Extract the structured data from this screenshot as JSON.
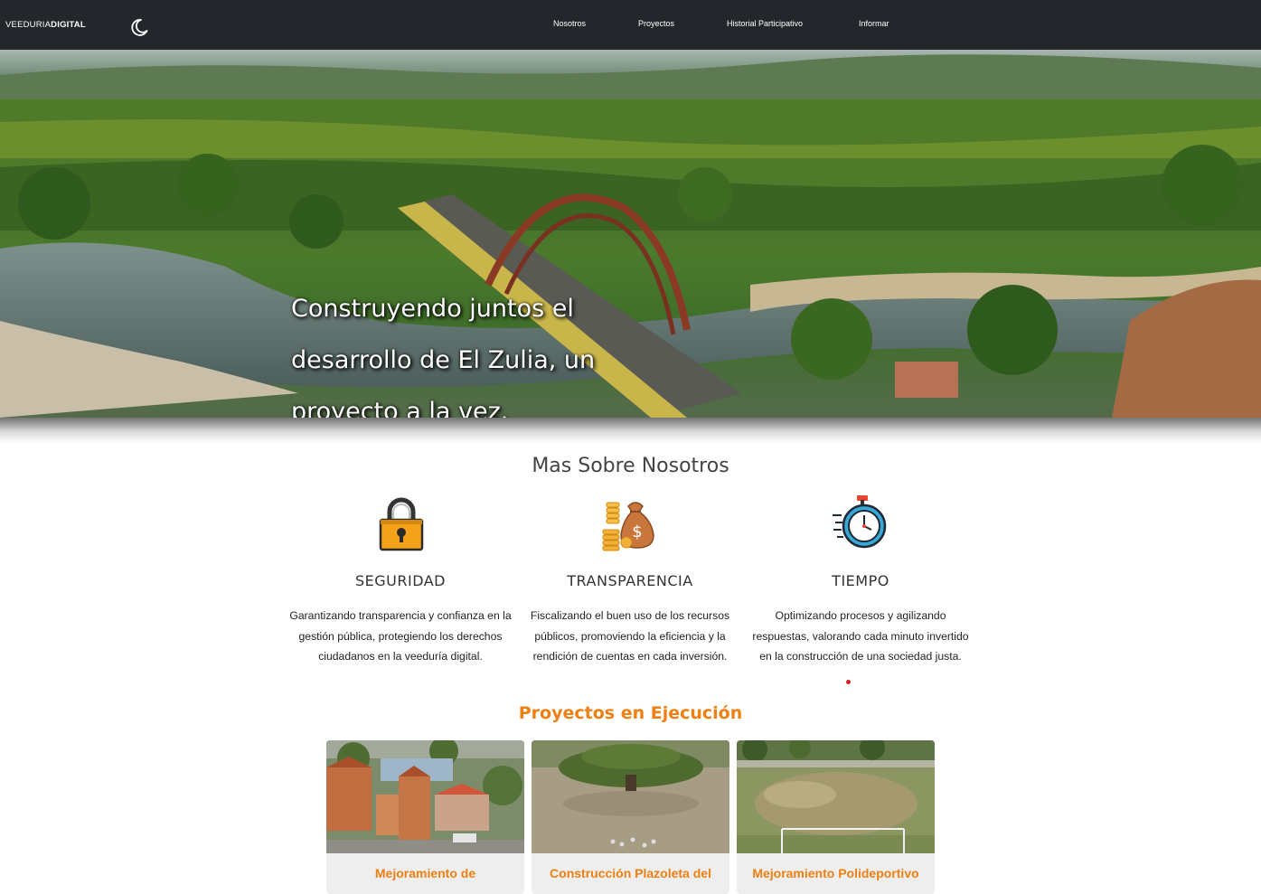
{
  "nav": {
    "brand_light": "VEEDURIA",
    "brand_bold": "DIGITAL",
    "theme_toggle_icon": "moon-icon",
    "links": [
      "Nosotros",
      "Proyectos",
      "Historial Participativo",
      "Informar"
    ]
  },
  "hero": {
    "title": "Construyendo juntos el desarrollo de El Zulia, un proyecto a la vez."
  },
  "about": {
    "title": "Mas Sobre Nosotros",
    "features": [
      {
        "icon": "padlock-icon",
        "title": "SEGURIDAD",
        "text": "Garantizando transparencia y confianza en la gestión pública, protegiendo los derechos ciudadanos en la veeduría digital."
      },
      {
        "icon": "money-bag-icon",
        "title": "TRANSPARENCIA",
        "text": "Fiscalizando el buen uso de los recursos públicos, promoviendo la eficiencia y la rendición de cuentas en cada inversión."
      },
      {
        "icon": "stopwatch-icon",
        "title": "TIEMPO",
        "text": "Optimizando procesos y agilizando respuestas, valorando cada minuto invertido en la construcción de una sociedad justa."
      }
    ]
  },
  "projects": {
    "title": "Proyectos en Ejecución",
    "cards": [
      {
        "title": "Mejoramiento de"
      },
      {
        "title": "Construcción Plazoleta del"
      },
      {
        "title": "Mejoramiento Polideportivo"
      }
    ]
  },
  "colors": {
    "navbar": "#23272b",
    "accent_orange": "#f07f12",
    "dot_red": "#d2232a"
  }
}
